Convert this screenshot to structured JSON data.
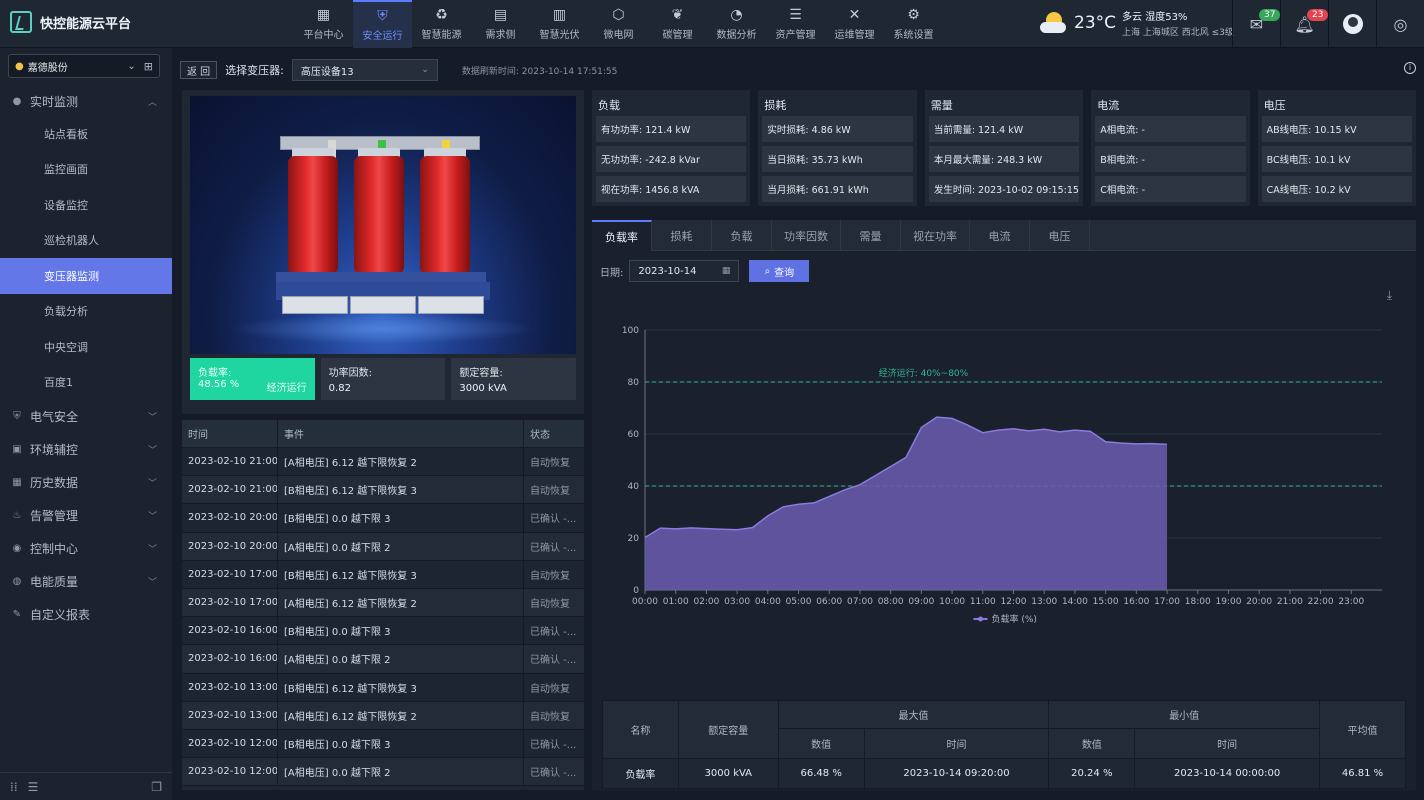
{
  "app": {
    "title": "快控能源云平台"
  },
  "nav": [
    {
      "label": "平台中心",
      "icon": "dashboard-icon",
      "glyph": "▦"
    },
    {
      "label": "安全运行",
      "icon": "shield-icon",
      "glyph": "⛨"
    },
    {
      "label": "智慧能源",
      "icon": "recycle-icon",
      "glyph": "♻"
    },
    {
      "label": "需求侧",
      "icon": "meter-icon",
      "glyph": "▤"
    },
    {
      "label": "智慧光伏",
      "icon": "solar-panel-icon",
      "glyph": "▥"
    },
    {
      "label": "微电网",
      "icon": "grid-icon",
      "glyph": "⬡"
    },
    {
      "label": "碳管理",
      "icon": "leaf-icon",
      "glyph": "❦"
    },
    {
      "label": "数据分析",
      "icon": "pie-chart-icon",
      "glyph": "◔"
    },
    {
      "label": "资产管理",
      "icon": "database-icon",
      "glyph": "☰"
    },
    {
      "label": "运维管理",
      "icon": "tools-icon",
      "glyph": "✕"
    },
    {
      "label": "系统设置",
      "icon": "gear-icon",
      "glyph": "⚙"
    }
  ],
  "weather": {
    "temp": "23°C",
    "condition": "多云",
    "humidity": "湿度53%",
    "location": "上海 上海城区 西北风 ≤3级"
  },
  "notifications": {
    "mail_count": "37",
    "bell_count": "23"
  },
  "sidebar": {
    "site": "嘉德股份",
    "groups": [
      {
        "label": "实时监测",
        "icon": "monitor-icon",
        "glyph": "●",
        "open": true,
        "items": [
          "站点看板",
          "监控画面",
          "设备监控",
          "巡检机器人",
          "变压器监测",
          "负载分析",
          "中央空调",
          "百度1"
        ]
      },
      {
        "label": "电气安全",
        "icon": "shield-icon",
        "glyph": "⛨"
      },
      {
        "label": "环境辅控",
        "icon": "chart-icon",
        "glyph": "▣"
      },
      {
        "label": "历史数据",
        "icon": "calendar-icon",
        "glyph": "▦"
      },
      {
        "label": "告警管理",
        "icon": "alarm-icon",
        "glyph": "♨"
      },
      {
        "label": "控制中心",
        "icon": "control-icon",
        "glyph": "◉"
      },
      {
        "label": "电能质量",
        "icon": "quality-icon",
        "glyph": "◍"
      },
      {
        "label": "自定义报表",
        "icon": "report-icon",
        "glyph": "✎"
      }
    ],
    "active_item": "变压器监测"
  },
  "toolbar": {
    "back": "返 回",
    "device_label": "选择变压器:",
    "device": "高压设备13",
    "refresh": "数据刷新时间: 2023-10-14 17:51:55"
  },
  "transformer_stats": {
    "load_rate_label": "负载率:",
    "load_rate": "48.56 %",
    "load_state": "经济运行",
    "pf_label": "功率因数:",
    "pf": "0.82",
    "capacity_label": "额定容量:",
    "capacity": "3000 kVA"
  },
  "events": {
    "headers": [
      "时间",
      "事件",
      "状态"
    ],
    "rows": [
      [
        "2023-02-10 21:00",
        "[A相电压] 6.12 越下限恢复 2",
        "自动恢复"
      ],
      [
        "2023-02-10 21:00",
        "[B相电压] 6.12 越下限恢复 3",
        "自动恢复"
      ],
      [
        "2023-02-10 20:00",
        "[B相电压] 0.0 越下限 3",
        "已确认 -..."
      ],
      [
        "2023-02-10 20:00",
        "[A相电压] 0.0 越下限 2",
        "已确认 -..."
      ],
      [
        "2023-02-10 17:00",
        "[B相电压] 6.12 越下限恢复 3",
        "自动恢复"
      ],
      [
        "2023-02-10 17:00",
        "[A相电压] 6.12 越下限恢复 2",
        "自动恢复"
      ],
      [
        "2023-02-10 16:00",
        "[B相电压] 0.0 越下限 3",
        "已确认 -..."
      ],
      [
        "2023-02-10 16:00",
        "[A相电压] 0.0 越下限 2",
        "已确认 -..."
      ],
      [
        "2023-02-10 13:00",
        "[B相电压] 6.12 越下限恢复 3",
        "自动恢复"
      ],
      [
        "2023-02-10 13:00",
        "[A相电压] 6.12 越下限恢复 2",
        "自动恢复"
      ],
      [
        "2023-02-10 12:00",
        "[B相电压] 0.0 越下限 3",
        "已确认 -..."
      ],
      [
        "2023-02-10 12:00",
        "[A相电压] 0.0 越下限 2",
        "已确认 -..."
      ]
    ]
  },
  "metrics": [
    {
      "title": "负载",
      "items": [
        "有功功率: 121.4 kW",
        "无功功率: -242.8 kVar",
        "视在功率: 1456.8 kVA"
      ]
    },
    {
      "title": "损耗",
      "items": [
        "实时损耗: 4.86 kW",
        "当日损耗: 35.73 kWh",
        "当月损耗: 661.91 kWh"
      ]
    },
    {
      "title": "需量",
      "items": [
        "当前需量: 121.4 kW",
        "本月最大需量: 248.3 kW",
        "发生时间: 2023-10-02 09:15:15"
      ]
    },
    {
      "title": "电流",
      "items": [
        "A相电流: -",
        "B相电流: -",
        "C相电流: -"
      ]
    },
    {
      "title": "电压",
      "items": [
        "AB线电压: 10.15 kV",
        "BC线电压: 10.1 kV",
        "CA线电压: 10.2 kV"
      ]
    }
  ],
  "tabs": [
    "负载率",
    "损耗",
    "负载",
    "功率因数",
    "需量",
    "视在功率",
    "电流",
    "电压"
  ],
  "filter": {
    "date_label": "日期:",
    "date": "2023-10-14",
    "query": "查询"
  },
  "chart_data": {
    "type": "area",
    "x": [
      "00:00",
      "00:30",
      "01:00",
      "01:30",
      "02:00",
      "02:30",
      "03:00",
      "03:30",
      "04:00",
      "04:30",
      "05:00",
      "05:30",
      "06:00",
      "06:30",
      "07:00",
      "07:30",
      "08:00",
      "08:30",
      "09:00",
      "09:30",
      "10:00",
      "10:30",
      "11:00",
      "11:30",
      "12:00",
      "12:30",
      "13:00",
      "13:30",
      "14:00",
      "14:30",
      "15:00",
      "15:30",
      "16:00",
      "16:30",
      "17:00"
    ],
    "series": [
      {
        "name": "负载率 (%)",
        "values": [
          20.2,
          23.8,
          23.5,
          23.9,
          23.6,
          23.4,
          23.2,
          24.0,
          28.5,
          32.0,
          33.0,
          33.5,
          36.0,
          38.5,
          40.5,
          44.0,
          47.5,
          51.0,
          62.5,
          66.5,
          66.0,
          63.5,
          60.5,
          61.5,
          62.0,
          61.2,
          61.8,
          60.8,
          61.5,
          61.0,
          57.0,
          56.5,
          56.2,
          56.3,
          56.0
        ]
      }
    ],
    "x_ticks": [
      "00:00",
      "01:00",
      "02:00",
      "03:00",
      "04:00",
      "05:00",
      "06:00",
      "07:00",
      "08:00",
      "09:00",
      "10:00",
      "11:00",
      "12:00",
      "13:00",
      "14:00",
      "15:00",
      "16:00",
      "17:00",
      "18:00",
      "19:00",
      "20:00",
      "21:00",
      "22:00",
      "23:00"
    ],
    "y_ticks": [
      0,
      20,
      40,
      60,
      80,
      100
    ],
    "ylim": [
      0,
      100
    ],
    "band": {
      "label": "经济运行: 40%~80%",
      "low": 40,
      "high": 80
    },
    "legend": "负载率 (%)",
    "colors": {
      "fill": "#6b5cb0",
      "line": "#8b7ae0",
      "band": "#2fb89a"
    }
  },
  "summary": {
    "h_name": "名称",
    "h_capacity": "额定容量",
    "h_max": "最大值",
    "h_min": "最小值",
    "h_avg": "平均值",
    "h_value": "数值",
    "h_time": "时间",
    "row": {
      "name": "负载率",
      "capacity": "3000 kVA",
      "max_value": "66.48 %",
      "max_time": "2023-10-14 09:20:00",
      "min_value": "20.24 %",
      "min_time": "2023-10-14 00:00:00",
      "avg": "46.81 %"
    }
  }
}
